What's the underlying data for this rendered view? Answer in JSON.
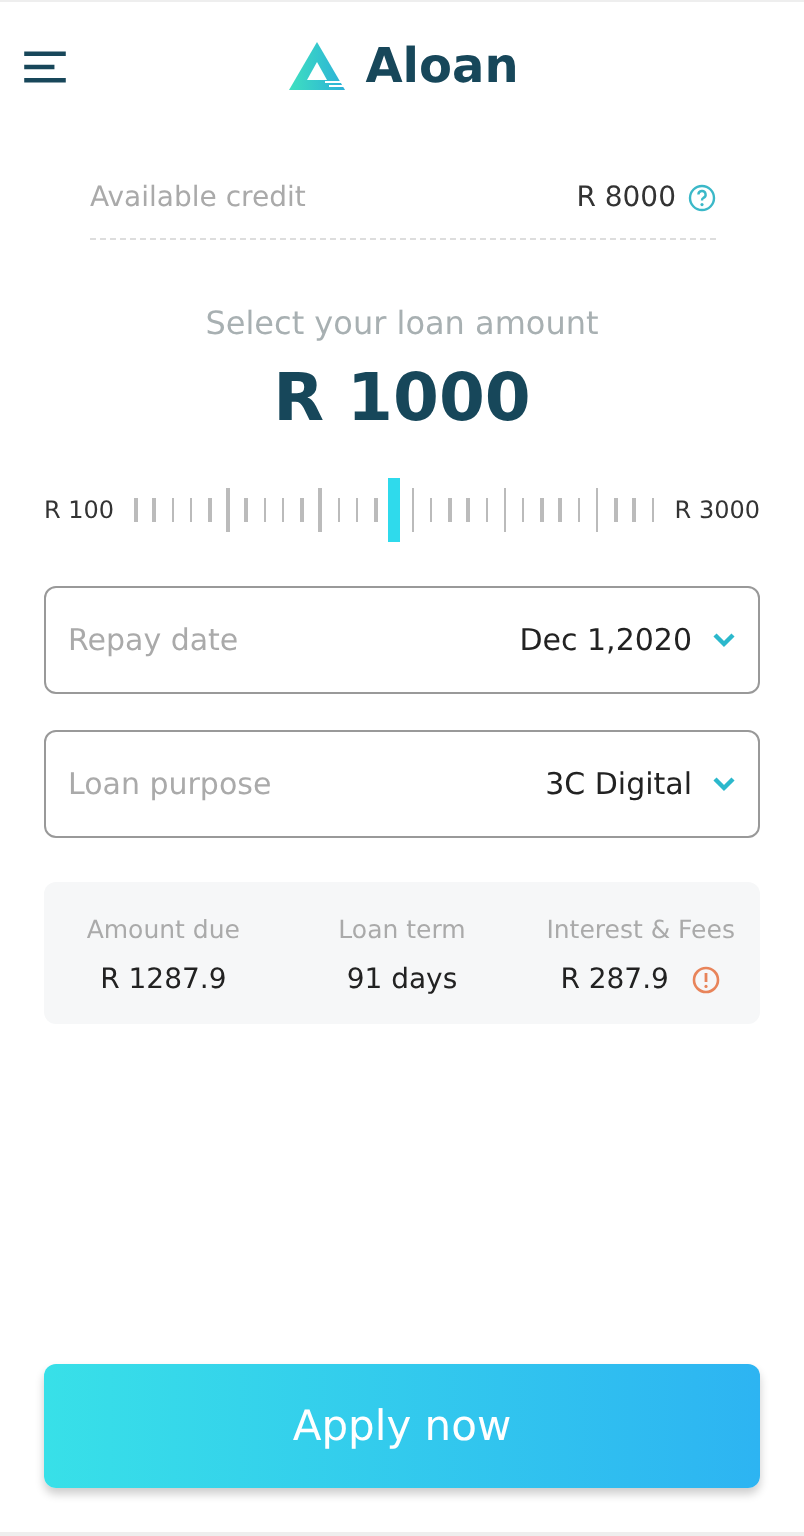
{
  "header": {
    "brand": "Aloan"
  },
  "credit": {
    "label": "Available credit",
    "value": "R 8000"
  },
  "amount": {
    "prompt": "Select your loan amount",
    "value": "R 1000",
    "min_label": "R 100",
    "max_label": "R 3000",
    "level": 0.5
  },
  "selects": [
    {
      "placeholder": "Repay date",
      "value": "Dec 1,2020"
    },
    {
      "placeholder": "Loan purpose",
      "value": "3C Digital"
    }
  ],
  "summary": [
    {
      "label": "Amount due",
      "value": "R 1287.9",
      "warning": false
    },
    {
      "label": "Loan term",
      "value": "91 days",
      "warning": false
    },
    {
      "label": "Interest & Fees",
      "value": "R 287.9",
      "warning": true
    }
  ],
  "button": "Apply now"
}
